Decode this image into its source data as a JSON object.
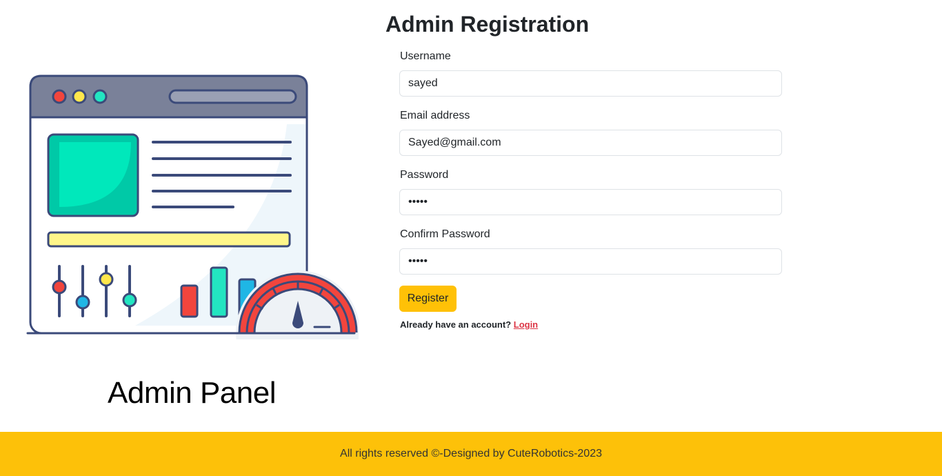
{
  "form": {
    "title": "Admin Registration",
    "username": {
      "label": "Username",
      "value": "sayed"
    },
    "email": {
      "label": "Email address",
      "value": "Sayed@gmail.com"
    },
    "password": {
      "label": "Password",
      "value": "•••••"
    },
    "confirm_password": {
      "label": "Confirm Password",
      "value": "•••••"
    },
    "register_label": "Register",
    "login_prompt": "Already have an account?",
    "login_link": "Login"
  },
  "illustration": {
    "caption": "Admin Panel",
    "icon": "admin-dashboard-illustration"
  },
  "footer": {
    "text": "All rights reserved ©-Designed by CuteRobotics-2023"
  },
  "colors": {
    "accent": "#ffc107",
    "footer_bg": "#fdc109",
    "link": "#dc3545"
  }
}
